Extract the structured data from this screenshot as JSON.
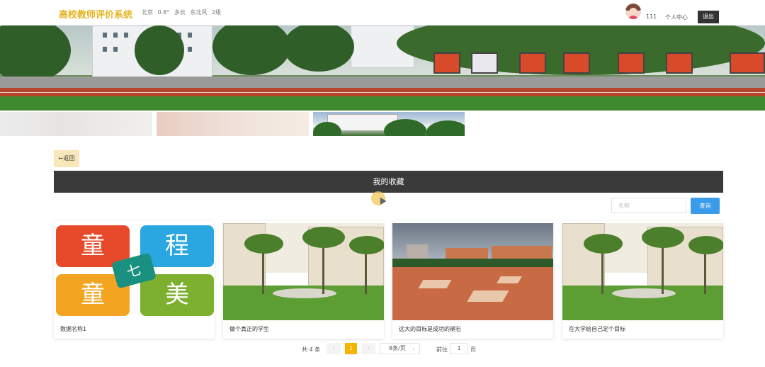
{
  "header": {
    "title": "高校教师评价系统",
    "weather": {
      "city": "北京",
      "temp": "0.8°",
      "condition": "多云",
      "wind": "东北风",
      "level": "2级"
    },
    "username": "111",
    "profile_link": "个人中心",
    "logout_label": "退出"
  },
  "back_label": "←返回",
  "section_title": "我的收藏",
  "search": {
    "placeholder": "名称",
    "button_label": "查询"
  },
  "cards": [
    {
      "label": "数据名称1",
      "logo_chars": [
        "童",
        "程",
        "童",
        "美",
        "七"
      ]
    },
    {
      "label": "做个真正的学生"
    },
    {
      "label": "远大的目标是成功的褪石"
    },
    {
      "label": "在大学给自己定个目标"
    }
  ],
  "pagination": {
    "total_text": "共 4 条",
    "prev": "‹",
    "current": "1",
    "next": "›",
    "page_size": "8条/页",
    "goto_label": "前往",
    "goto_value": "1",
    "page_unit": "页"
  },
  "colors": {
    "brand": "#e6b422",
    "accent": "#f5b400",
    "search_button": "#3a9be9",
    "section_bar": "#3a3a3a",
    "logout": "#333333"
  }
}
